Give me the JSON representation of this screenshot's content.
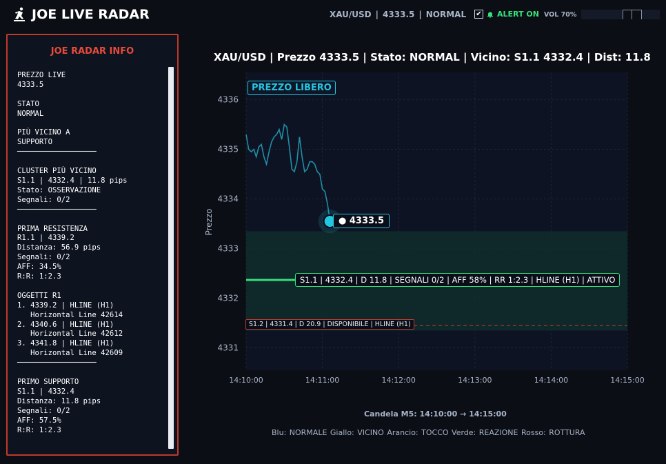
{
  "app": {
    "title": "JOE LIVE RADAR",
    "logo_icon": "runner-icon"
  },
  "status_bar": {
    "symbol": "XAU/USD",
    "separator": "|",
    "price": "4333.5",
    "state": "NORMAL",
    "alert_checked": true,
    "alert_icon": "bell-icon",
    "alert_label": "ALERT ON",
    "volume_label": "VOL 70%",
    "volume_level": 0.7
  },
  "panel": {
    "title": "JOE RADAR INFO",
    "text": "PREZZO LIVE\n4333.5\n\nSTATO\nNORMAL\n\nPIÙ VICINO A\nSUPPORTO\n──────────────────\n\nCLUSTER PIÙ VICINO\nS1.1 | 4332.4 | 11.8 pips\nStato: OSSERVAZIONE\nSegnali: 0/2\n──────────────────\n\nPRIMA RESISTENZA\nR1.1 | 4339.2\nDistanza: 56.9 pips\nSegnali: 0/2\nAFF: 34.5%\nR:R: 1:2.3\n\nOGGETTI R1\n1. 4339.2 | HLINE (H1)\n   Horizontal Line 42614\n2. 4340.6 | HLINE (H1)\n   Horizontal Line 42612\n3. 4341.8 | HLINE (H1)\n   Horizontal Line 42609\n──────────────────\n\nPRIMO SUPPORTO\nS1.1 | 4332.4\nDistanza: 11.8 pips\nSegnali: 0/2\nAFF: 57.5%\nR:R: 1:2.3"
  },
  "chart": {
    "title": "XAU/USD | Prezzo 4333.5 | Stato: NORMAL | Vicino: S1.1 4332.4 | Dist: 11.8",
    "badge": "PREZZO LIBERO",
    "price_label": "● 4333.5",
    "s1_label": "S1.1 | 4332.4 | D 11.8 | SEGNALI 0/2 | AFF 58% | RR 1:2.3 | HLINE (H1) | ATTIVO",
    "s2_label": "S1.2 | 4331.4 | D 20.9 | DISPONIBILE | HLINE (H1)",
    "caption": "Candela M5: 14:10:00 → 14:15:00",
    "legend": "Blu: NORMALE   Giallo: VICINO   Arancio: TOCCO   Verde: REAZIONE   Rosso: ROTTURA"
  },
  "chart_data": {
    "type": "line",
    "title": "XAU/USD | Prezzo 4333.5 | Stato: NORMAL | Vicino: S1.1 4332.4 | Dist: 11.8",
    "xlabel": "",
    "ylabel": "Prezzo",
    "x_ticks": [
      "14:10:00",
      "14:11:00",
      "14:12:00",
      "14:13:00",
      "14:14:00",
      "14:15:00"
    ],
    "y_ticks": [
      4331,
      4332,
      4333,
      4334,
      4335,
      4336
    ],
    "xlim": [
      0,
      300
    ],
    "ylim": [
      4330.55,
      4336.55
    ],
    "grid": true,
    "series": [
      {
        "color": "#1f8fa6",
        "x": [
          0,
          2,
          4,
          6,
          8,
          10,
          12,
          14,
          16,
          18,
          20,
          22,
          24,
          26,
          28,
          30,
          32,
          34,
          36,
          38,
          40,
          42,
          44,
          46,
          48,
          50,
          52,
          54,
          56,
          58,
          60,
          62,
          64,
          66
        ],
        "values": [
          4335.3,
          4335.0,
          4334.95,
          4335.0,
          4334.85,
          4335.05,
          4335.1,
          4334.85,
          4334.7,
          4334.95,
          4335.15,
          4335.25,
          4335.3,
          4335.4,
          4335.2,
          4335.5,
          4335.45,
          4335.05,
          4334.6,
          4334.55,
          4334.75,
          4335.25,
          4334.85,
          4334.55,
          4334.6,
          4334.75,
          4334.75,
          4334.7,
          4334.55,
          4334.5,
          4334.2,
          4334.15,
          4333.9,
          4333.55
        ]
      }
    ],
    "current_price": {
      "x": 66,
      "y": 4333.55,
      "color": "#23c6e0"
    },
    "zone": {
      "y_from": 4331.35,
      "y_to": 4333.35,
      "color": "#10302c"
    },
    "levels": [
      {
        "name": "S1.1",
        "y": 4332.37,
        "color": "#36e07a",
        "style": "solid",
        "x_end": 40
      },
      {
        "name": "S1.2",
        "y": 4331.45,
        "color": "#c0392b",
        "style": "dashed"
      }
    ]
  }
}
